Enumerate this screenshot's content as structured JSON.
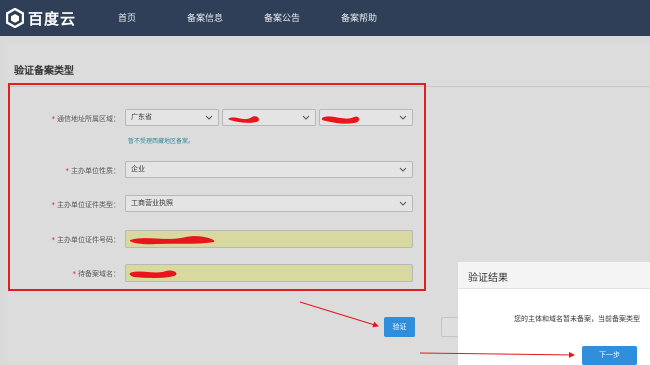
{
  "header": {
    "logo_text": "百度云",
    "nav": [
      "首页",
      "备案信息",
      "备案公告",
      "备案帮助"
    ]
  },
  "panel": {
    "title": "验证备案类型"
  },
  "form": {
    "region_label": "通信地址所属区域：",
    "region_province": "广东省",
    "region_hint": "暂不受理西藏地区备案。",
    "org_nature_label": "主办单位性质：",
    "org_nature_value": "企业",
    "cert_type_label": "主办单位证件类型：",
    "cert_type_value": "工商营业执照",
    "cert_no_label": "主办单位证件号码：",
    "domain_label": "待备案域名："
  },
  "actions": {
    "verify_label": "验证"
  },
  "dialog": {
    "title": "验证结果",
    "message": "您的主体和域名暂未备案，当前备案类型",
    "next_label": "下一步"
  },
  "colors": {
    "header_bg": "#2f3f57",
    "highlight_border": "#e0201b",
    "primary_button": "#2f8fdc",
    "annotation_red": "#e8151a"
  }
}
